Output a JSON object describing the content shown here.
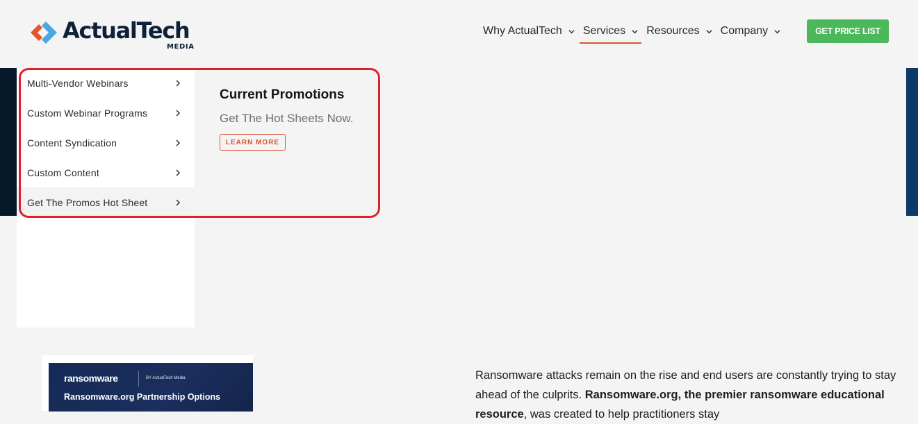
{
  "header": {
    "logo_text": "ActualTech",
    "logo_sub": "MEDIA",
    "nav": [
      {
        "label": "Why ActualTech",
        "active": false
      },
      {
        "label": "Services",
        "active": true
      },
      {
        "label": "Resources",
        "active": false
      },
      {
        "label": "Company",
        "active": false
      }
    ],
    "cta_label": "GET PRICE LIST"
  },
  "services_menu": {
    "items": [
      {
        "label": "Multi-Vendor Webinars"
      },
      {
        "label": "Custom Webinar Programs"
      },
      {
        "label": "Content Syndication"
      },
      {
        "label": "Custom Content"
      },
      {
        "label": "Get The Promos Hot Sheet"
      }
    ],
    "promo": {
      "title": "Current Promotions",
      "subtitle": "Get The Hot Sheets Now.",
      "button_label": "LEARN MORE"
    }
  },
  "content": {
    "partner_image": {
      "brand": "ransomware",
      "by_text": "BY  ActualTech Media",
      "title": "Ransomware.org Partnership Options"
    },
    "paragraph": {
      "part1": "Ransomware attacks remain on the rise and end users are constantly trying to stay ahead of the culprits. ",
      "bold": "Ransomware.org, the premier ransomware educational resource",
      "part2": ", was created to help practitioners stay"
    }
  },
  "colors": {
    "accent": "#d9532b",
    "cta": "#4cb85c",
    "logo_navy": "#0f2138",
    "highlight": "#e0202e"
  }
}
